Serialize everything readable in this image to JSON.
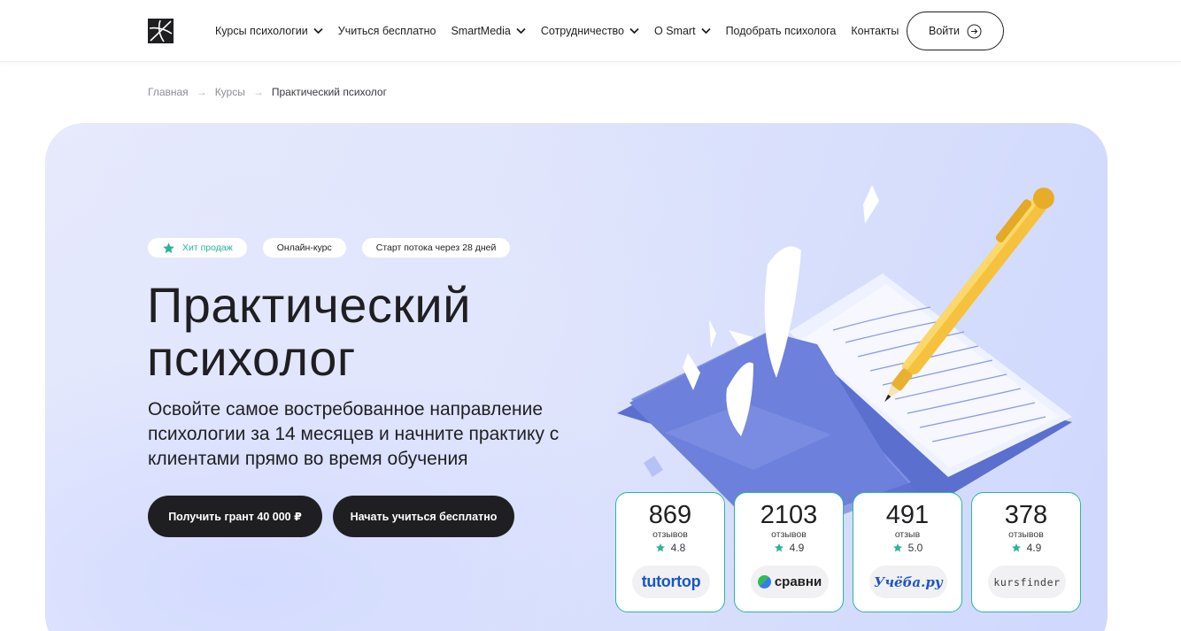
{
  "header": {
    "nav": [
      {
        "label": "Курсы психологии",
        "dropdown": true
      },
      {
        "label": "Учиться бесплатно",
        "dropdown": false
      },
      {
        "label": "SmartMedia",
        "dropdown": true
      },
      {
        "label": "Сотрудничество",
        "dropdown": true
      },
      {
        "label": "О Smart",
        "dropdown": true
      },
      {
        "label": "Подобрать психолога",
        "dropdown": false
      },
      {
        "label": "Контакты",
        "dropdown": false
      }
    ],
    "login_label": "Войти"
  },
  "breadcrumb": {
    "home": "Главная",
    "courses": "Курсы",
    "current": "Практический психолог",
    "separator": "→"
  },
  "hero": {
    "tags": {
      "hit": "Хит продаж",
      "format": "Онлайн-курс",
      "start": "Старт потока через 28 дней"
    },
    "title_line1": "Практический",
    "title_line2": "психолог",
    "subtitle": "Освойте самое востребованное направление психологии за 14 месяцев и начните практику с клиентами прямо во время обучения",
    "grant_button": "Получить грант 40 000 ₽",
    "free_button": "Начать учиться бесплатно"
  },
  "reviews": [
    {
      "count": "869",
      "word": "отзывов",
      "rating": "4.8",
      "brand": "tutortop"
    },
    {
      "count": "2103",
      "word": "отзывов",
      "rating": "4.9",
      "brand": "сравни"
    },
    {
      "count": "491",
      "word": "отзыв",
      "rating": "5.0",
      "brand": "Учёба.ру"
    },
    {
      "count": "378",
      "word": "отзывов",
      "rating": "4.9",
      "brand": "kursfinder"
    }
  ],
  "colors": {
    "accent_teal": "#28b79d",
    "dark_button": "#1f1f22",
    "hero_background": "#dde3fc",
    "tutortop_blue": "#1657c8"
  },
  "icons": {
    "logo": "smart-logo-icon",
    "chevron": "chevron-down-icon",
    "login_arrow": "arrow-right-circle-icon",
    "star": "star-icon"
  }
}
